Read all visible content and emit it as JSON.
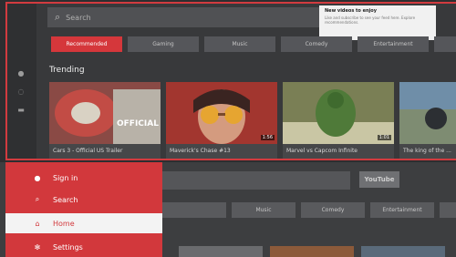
{
  "top": {
    "search": {
      "placeholder": "Search"
    },
    "tooltip": {
      "title": "New videos to enjoy",
      "text": "Like and subscribe to see your feed here. Explore recommendations."
    },
    "tabs": [
      {
        "label": "Recommended",
        "active": true
      },
      {
        "label": "Gaming",
        "active": false
      },
      {
        "label": "Music",
        "active": false
      },
      {
        "label": "Comedy",
        "active": false
      },
      {
        "label": "Entertainment",
        "active": false
      },
      {
        "label": "",
        "active": false
      }
    ],
    "section_title": "Trending",
    "videos": [
      {
        "title": "Cars 3 - Official US Trailer",
        "duration": "",
        "overlay_text": "OFFICIAL TRAIL..."
      },
      {
        "title": "Maverick's Chase #13",
        "duration": "1:56"
      },
      {
        "title": "Marvel vs Capcom Infinite",
        "duration": "1:01"
      },
      {
        "title": "The king of the ...",
        "duration": ""
      }
    ]
  },
  "bottom": {
    "menu": [
      {
        "label": "Sign in",
        "icon": "user-icon",
        "selected": false
      },
      {
        "label": "Search",
        "icon": "search-icon",
        "selected": false
      },
      {
        "label": "Home",
        "icon": "home-icon",
        "selected": true
      },
      {
        "label": "Settings",
        "icon": "gear-icon",
        "selected": false
      }
    ],
    "logo": "YouTube",
    "tabs": [
      "",
      "Music",
      "Comedy",
      "Entertainment",
      ""
    ]
  },
  "colors": {
    "accent": "#d5373b",
    "background": "#38393b",
    "tab": "#55565a"
  }
}
